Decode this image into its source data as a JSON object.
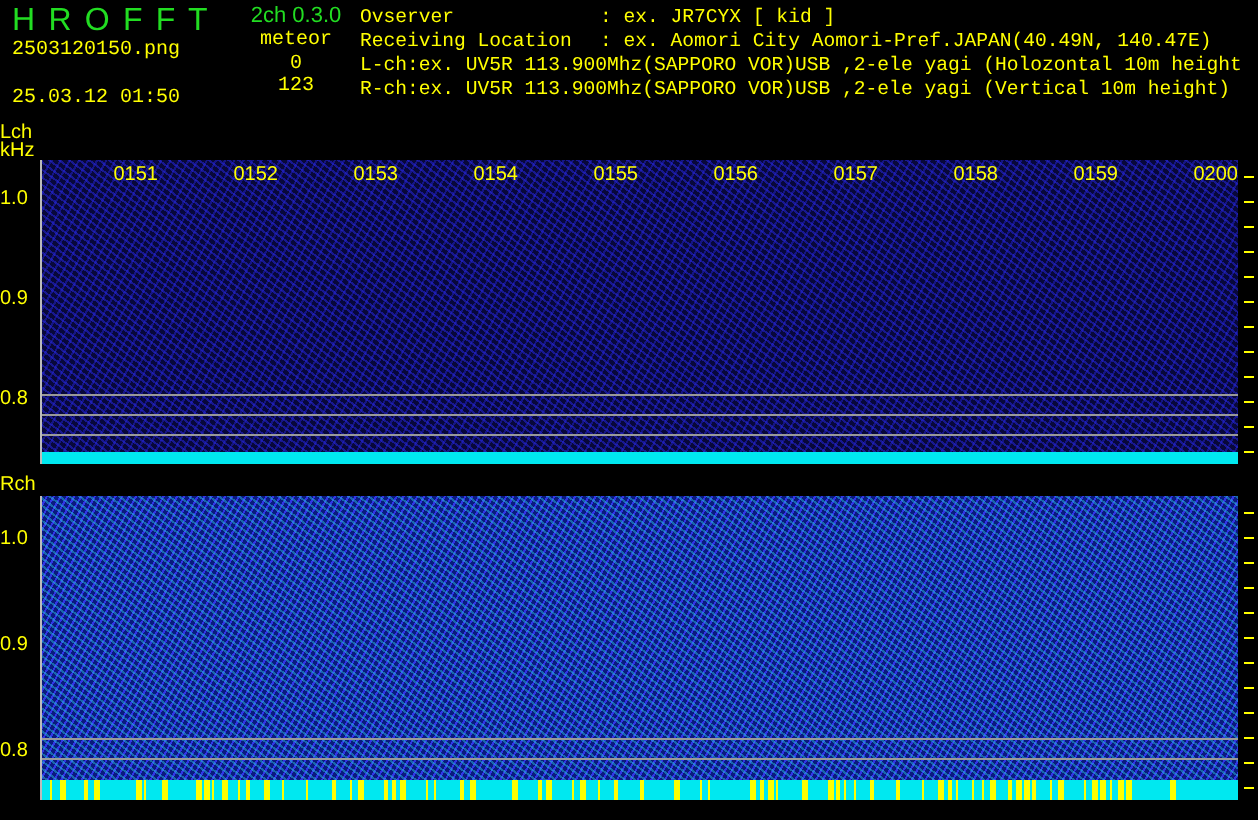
{
  "header": {
    "title": "H R O F F T",
    "version": "2ch 0.3.0",
    "filename": "2503120150.png",
    "datetime": "25.03.12 01:50",
    "counter_label": "meteor",
    "counts": [
      "0",
      "123"
    ],
    "info_lines": [
      {
        "label": "Ovserver",
        "value": ": ex. JR7CYX [ kid ]"
      },
      {
        "label": "Receiving Location",
        "value": ": ex. Aomori City Aomori-Pref.JAPAN(40.49N, 140.47E)"
      }
    ],
    "channel_lines": [
      "L-ch:ex. UV5R 113.900Mhz(SAPPORO VOR)USB ,2-ele yagi (Holozontal 10m height",
      "R-ch:ex. UV5R 113.900Mhz(SAPPORO VOR)USB ,2-ele yagi (Vertical 10m height)"
    ]
  },
  "channels": [
    {
      "kind": "left",
      "label": "Lch",
      "unit": "kHz",
      "time_labels": [
        "0151",
        "0152",
        "0153",
        "0154",
        "0155",
        "0156",
        "0157",
        "0158",
        "0159",
        "0200"
      ],
      "y_labels": [
        "1.0",
        "0.9",
        "0.8"
      ]
    },
    {
      "kind": "right",
      "label": "Rch",
      "y_labels": [
        "1.0",
        "0.9",
        "0.8"
      ]
    }
  ]
}
